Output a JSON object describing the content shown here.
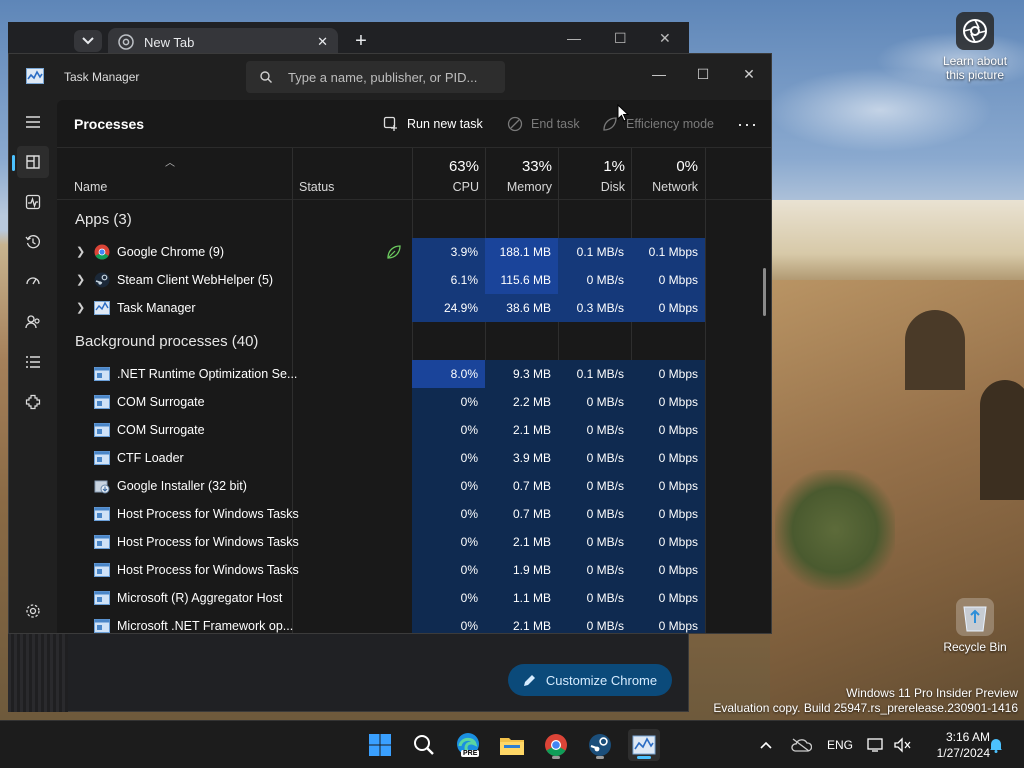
{
  "desktop": {
    "learn_label": "Learn about this picture",
    "recycle_label": "Recycle Bin",
    "watermark_line1": "Windows 11 Pro Insider Preview",
    "watermark_line2": "Evaluation copy. Build 25947.rs_prerelease.230901-1416"
  },
  "chrome": {
    "tab_title": "New Tab",
    "customize_label": "Customize Chrome"
  },
  "task_manager": {
    "title": "Task Manager",
    "search_placeholder": "Type a name, publisher, or PID...",
    "page_title": "Processes",
    "toolbar": {
      "run_new_task": "Run new task",
      "end_task": "End task",
      "efficiency_mode": "Efficiency mode"
    },
    "columns": {
      "name": "Name",
      "status": "Status",
      "cpu_pct": "63%",
      "cpu": "CPU",
      "mem_pct": "33%",
      "mem": "Memory",
      "disk_pct": "1%",
      "disk": "Disk",
      "net_pct": "0%",
      "net": "Network"
    },
    "groups": {
      "apps": "Apps (3)",
      "background": "Background processes (40)"
    },
    "apps": [
      {
        "name": "Google Chrome (9)",
        "cpu": "3.9%",
        "mem": "188.1 MB",
        "disk": "0.1 MB/s",
        "net": "0.1 Mbps"
      },
      {
        "name": "Steam Client WebHelper (5)",
        "cpu": "6.1%",
        "mem": "115.6 MB",
        "disk": "0 MB/s",
        "net": "0 Mbps"
      },
      {
        "name": "Task Manager",
        "cpu": "24.9%",
        "mem": "38.6 MB",
        "disk": "0.3 MB/s",
        "net": "0 Mbps"
      }
    ],
    "background": [
      {
        "name": ".NET Runtime Optimization Se...",
        "cpu": "8.0%",
        "mem": "9.3 MB",
        "disk": "0.1 MB/s",
        "net": "0 Mbps"
      },
      {
        "name": "COM Surrogate",
        "cpu": "0%",
        "mem": "2.2 MB",
        "disk": "0 MB/s",
        "net": "0 Mbps"
      },
      {
        "name": "COM Surrogate",
        "cpu": "0%",
        "mem": "2.1 MB",
        "disk": "0 MB/s",
        "net": "0 Mbps"
      },
      {
        "name": "CTF Loader",
        "cpu": "0%",
        "mem": "3.9 MB",
        "disk": "0 MB/s",
        "net": "0 Mbps"
      },
      {
        "name": "Google Installer (32 bit)",
        "cpu": "0%",
        "mem": "0.7 MB",
        "disk": "0 MB/s",
        "net": "0 Mbps"
      },
      {
        "name": "Host Process for Windows Tasks",
        "cpu": "0%",
        "mem": "0.7 MB",
        "disk": "0 MB/s",
        "net": "0 Mbps"
      },
      {
        "name": "Host Process for Windows Tasks",
        "cpu": "0%",
        "mem": "2.1 MB",
        "disk": "0 MB/s",
        "net": "0 Mbps"
      },
      {
        "name": "Host Process for Windows Tasks",
        "cpu": "0%",
        "mem": "1.9 MB",
        "disk": "0 MB/s",
        "net": "0 Mbps"
      },
      {
        "name": "Microsoft (R) Aggregator Host",
        "cpu": "0%",
        "mem": "1.1 MB",
        "disk": "0 MB/s",
        "net": "0 Mbps"
      },
      {
        "name": "Microsoft .NET Framework op...",
        "cpu": "0%",
        "mem": "2.1 MB",
        "disk": "0 MB/s",
        "net": "0 Mbps"
      }
    ]
  },
  "taskbar": {
    "language": "ENG",
    "time": "3:16 AM",
    "date": "1/27/2024",
    "edge_badge": "PRE"
  },
  "colors": {
    "accent": "#4cc2ff",
    "heat_low": "#0f2a50",
    "heat_mid": "#15397a",
    "heat_high": "#1a449a",
    "tm_bg": "#202020"
  }
}
